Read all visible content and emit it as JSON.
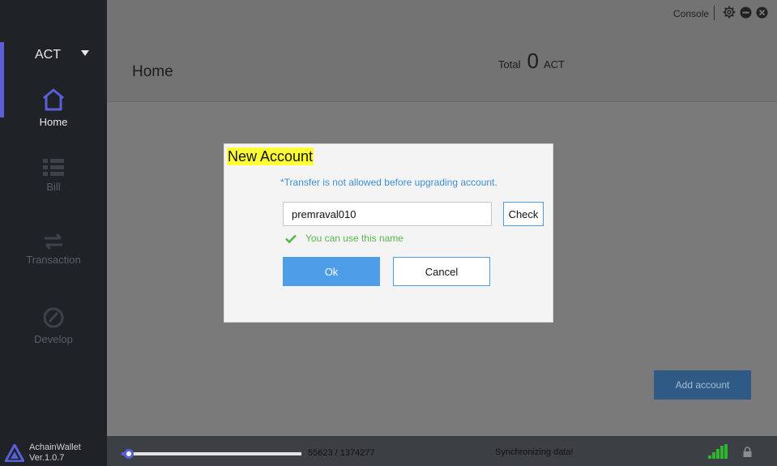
{
  "sidebar": {
    "coin": "ACT",
    "items": [
      {
        "label": "Home"
      },
      {
        "label": "Bill"
      },
      {
        "label": "Transaction"
      },
      {
        "label": "Develop"
      }
    ],
    "brand": {
      "name": "AchainWallet",
      "version": "Ver.1.0.7"
    }
  },
  "header": {
    "console_label": "Console",
    "page_title": "Home",
    "total_label": "Total",
    "total_value": "0",
    "total_unit": "ACT"
  },
  "main": {
    "add_account_label": "Add account"
  },
  "statusbar": {
    "progress_text": "55623 / 1374277",
    "progress_fraction": 0.0405,
    "sync_text": "Synchronizing data!"
  },
  "modal": {
    "title": "New Account",
    "note": "*Transfer is not allowed before upgrading account.",
    "name_value": "premraval010",
    "check_label": "Check",
    "valid_text": "You can use this name",
    "ok_label": "Ok",
    "cancel_label": "Cancel"
  },
  "colors": {
    "accent": "#5a5fd6",
    "primary_button": "#4d9de9",
    "success": "#58b84c",
    "title_highlight": "#ffff33"
  }
}
